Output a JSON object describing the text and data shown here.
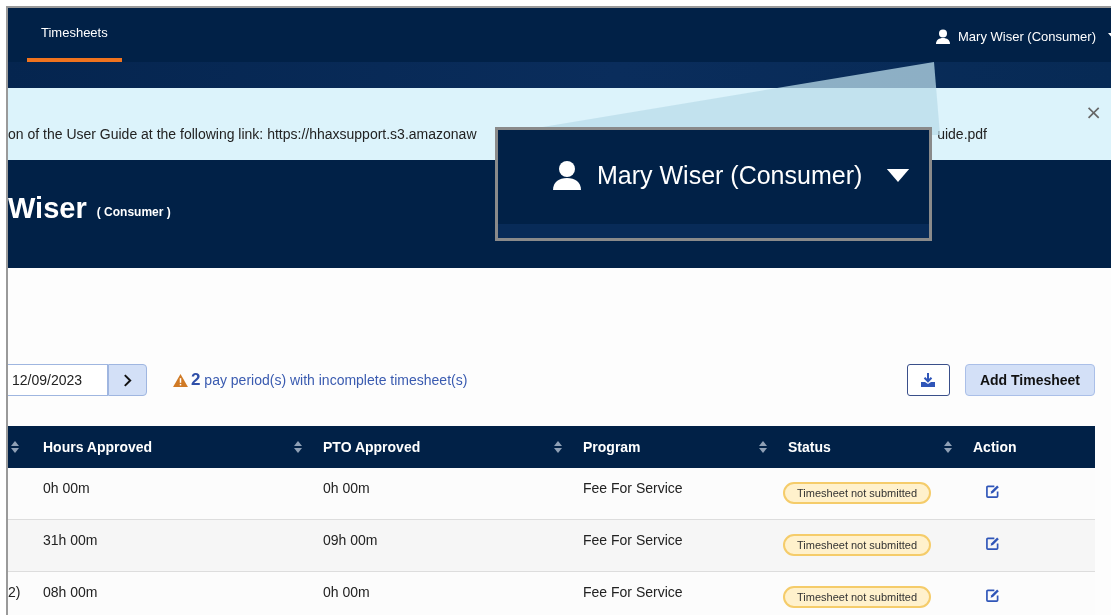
{
  "nav": {
    "tabs": [
      {
        "label": "Timesheets",
        "selected": true
      }
    ],
    "user": {
      "name": "Mary Wiser (Consumer)"
    }
  },
  "banner": {
    "text_before": "on of the User Guide at the following link: https://hhaxsupport.s3.amazonaw",
    "text_after": "uide.pdf",
    "close": "×"
  },
  "header": {
    "name": "Wiser",
    "role": "( Consumer )"
  },
  "toolbar": {
    "date": "12/09/2023",
    "alert": {
      "count": "2",
      "text": "pay period(s) with incomplete timesheet(s)"
    },
    "add_button": "Add Timesheet"
  },
  "table": {
    "columns": [
      {
        "sortable": true
      },
      {
        "label": "Hours Approved",
        "sortable": true
      },
      {
        "label": "PTO Approved",
        "sortable": true
      },
      {
        "label": "Program",
        "sortable": true
      },
      {
        "label": "Status",
        "sortable": true
      },
      {
        "label": "Action",
        "sortable": false
      }
    ],
    "rows": [
      {
        "hours_approved": "0h 00m",
        "pto_approved": "0h 00m",
        "program": "Fee For Service",
        "status": "Timesheet not submitted"
      },
      {
        "hours_approved": "31h 00m",
        "pto_approved": "09h 00m",
        "program": "Fee For Service",
        "status": "Timesheet not submitted"
      },
      {
        "column_1": "2)",
        "hours_approved": "08h 00m",
        "pto_approved": "0h 00m",
        "program": "Fee For Service",
        "status": "Timesheet not submitted"
      }
    ]
  },
  "callout": {
    "user_name": "Mary Wiser (Consumer)"
  }
}
